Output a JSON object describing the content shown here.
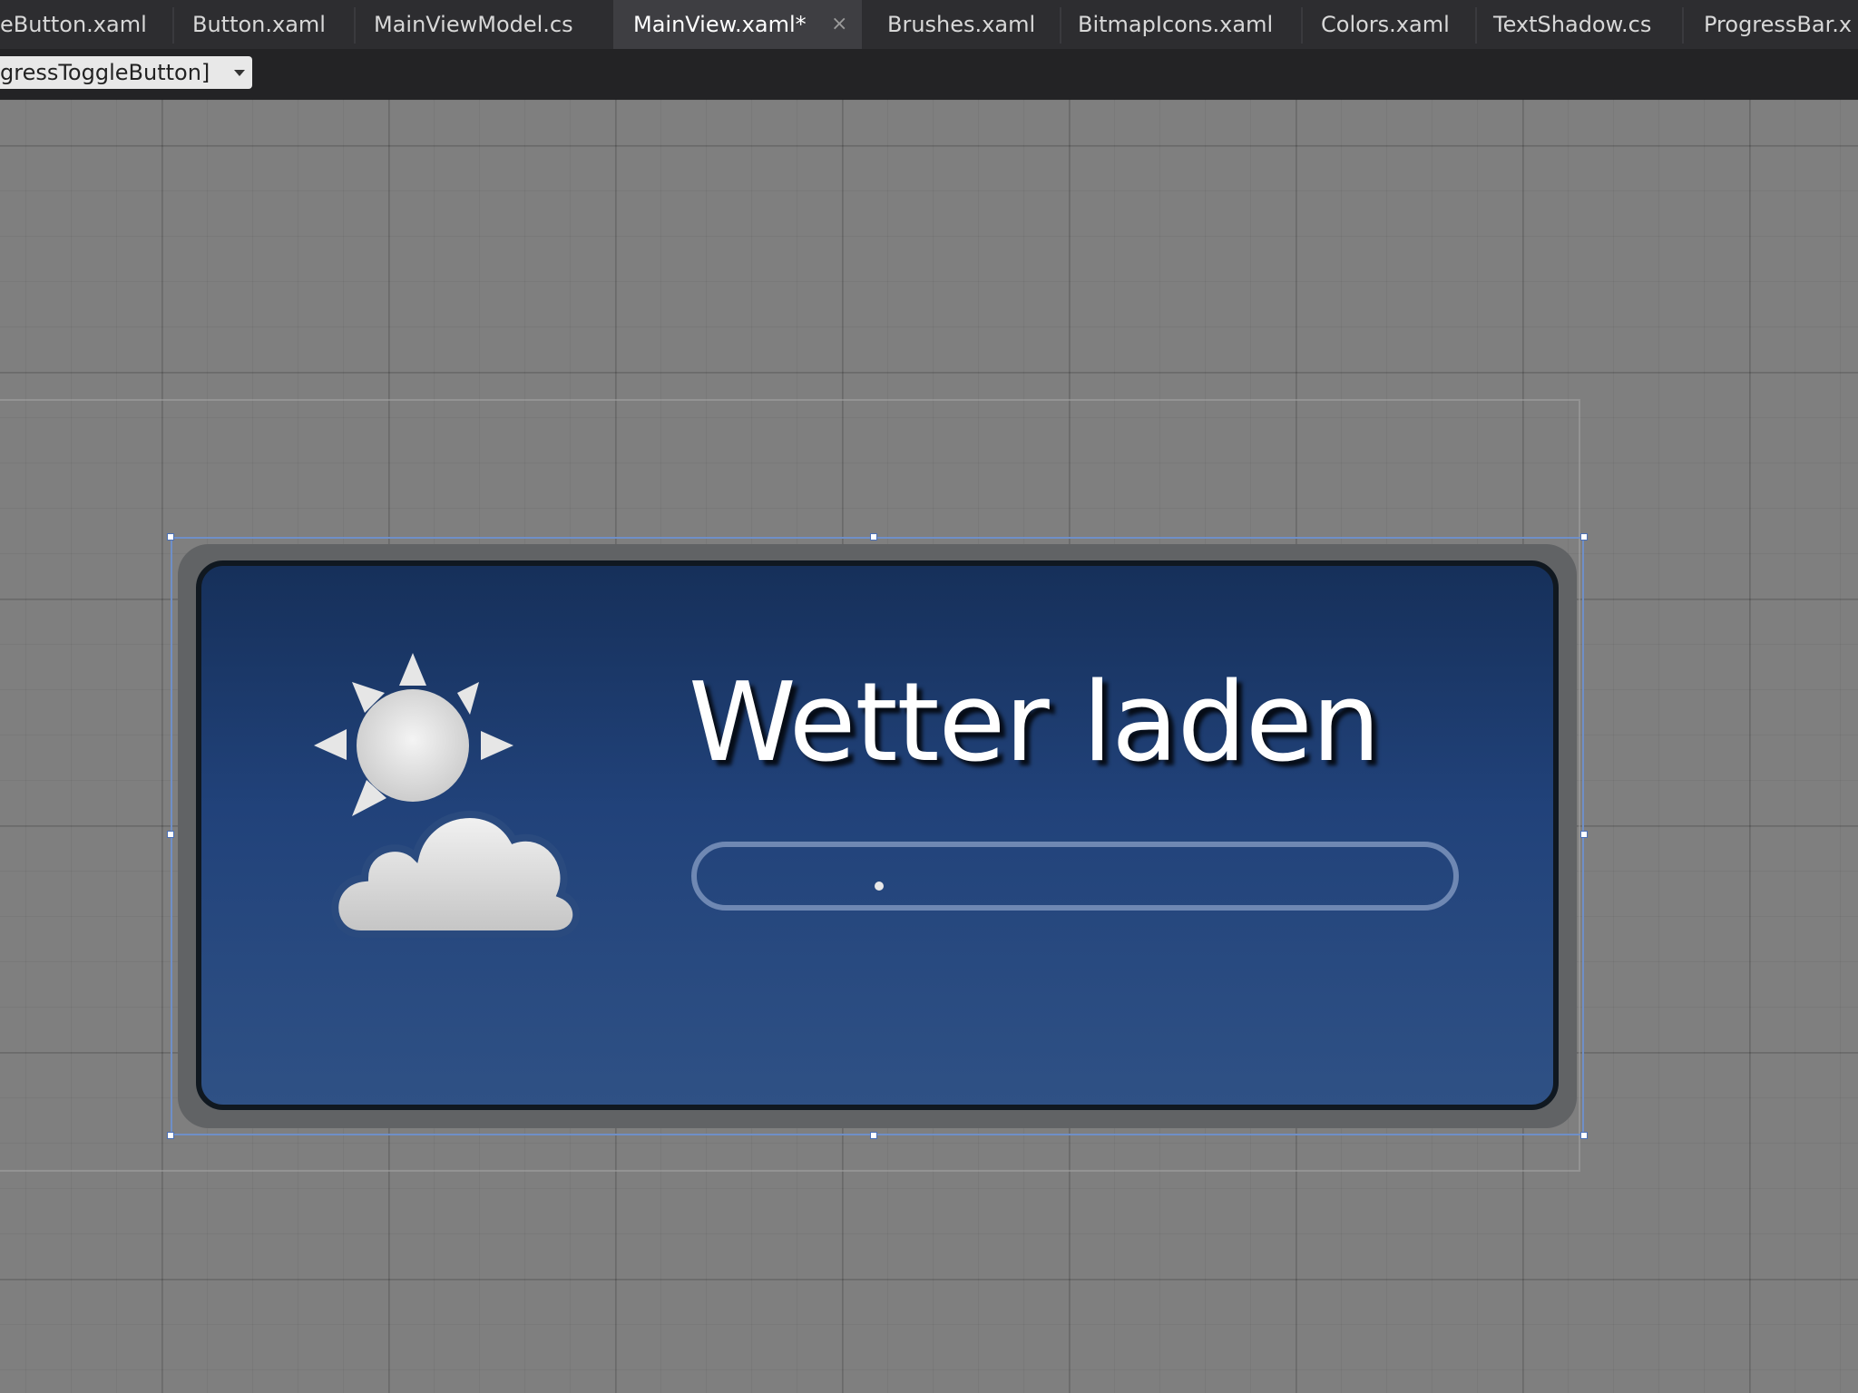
{
  "tabs": [
    {
      "label": "eButton.xaml",
      "active": false
    },
    {
      "label": "Button.xaml",
      "active": false
    },
    {
      "label": "MainViewModel.cs",
      "active": false
    },
    {
      "label": "MainView.xaml*",
      "active": true
    },
    {
      "label": "Brushes.xaml",
      "active": false
    },
    {
      "label": "BitmapIcons.xaml",
      "active": false
    },
    {
      "label": "Colors.xaml",
      "active": false
    },
    {
      "label": "TextShadow.cs",
      "active": false
    },
    {
      "label": "ProgressBar.x",
      "active": false
    }
  ],
  "active_tab_close": "×",
  "element_selector": {
    "label": "gressToggleButton]"
  },
  "button": {
    "title": "Wetter laden",
    "icon": "sun-behind-cloud-icon",
    "progress": 0
  },
  "colors": {
    "tab_bar": "#2d2d30",
    "canvas": "#7f7f7f",
    "button_top": "#16305a",
    "button_bottom": "#2f5185",
    "selection": "#6f8fc7"
  }
}
